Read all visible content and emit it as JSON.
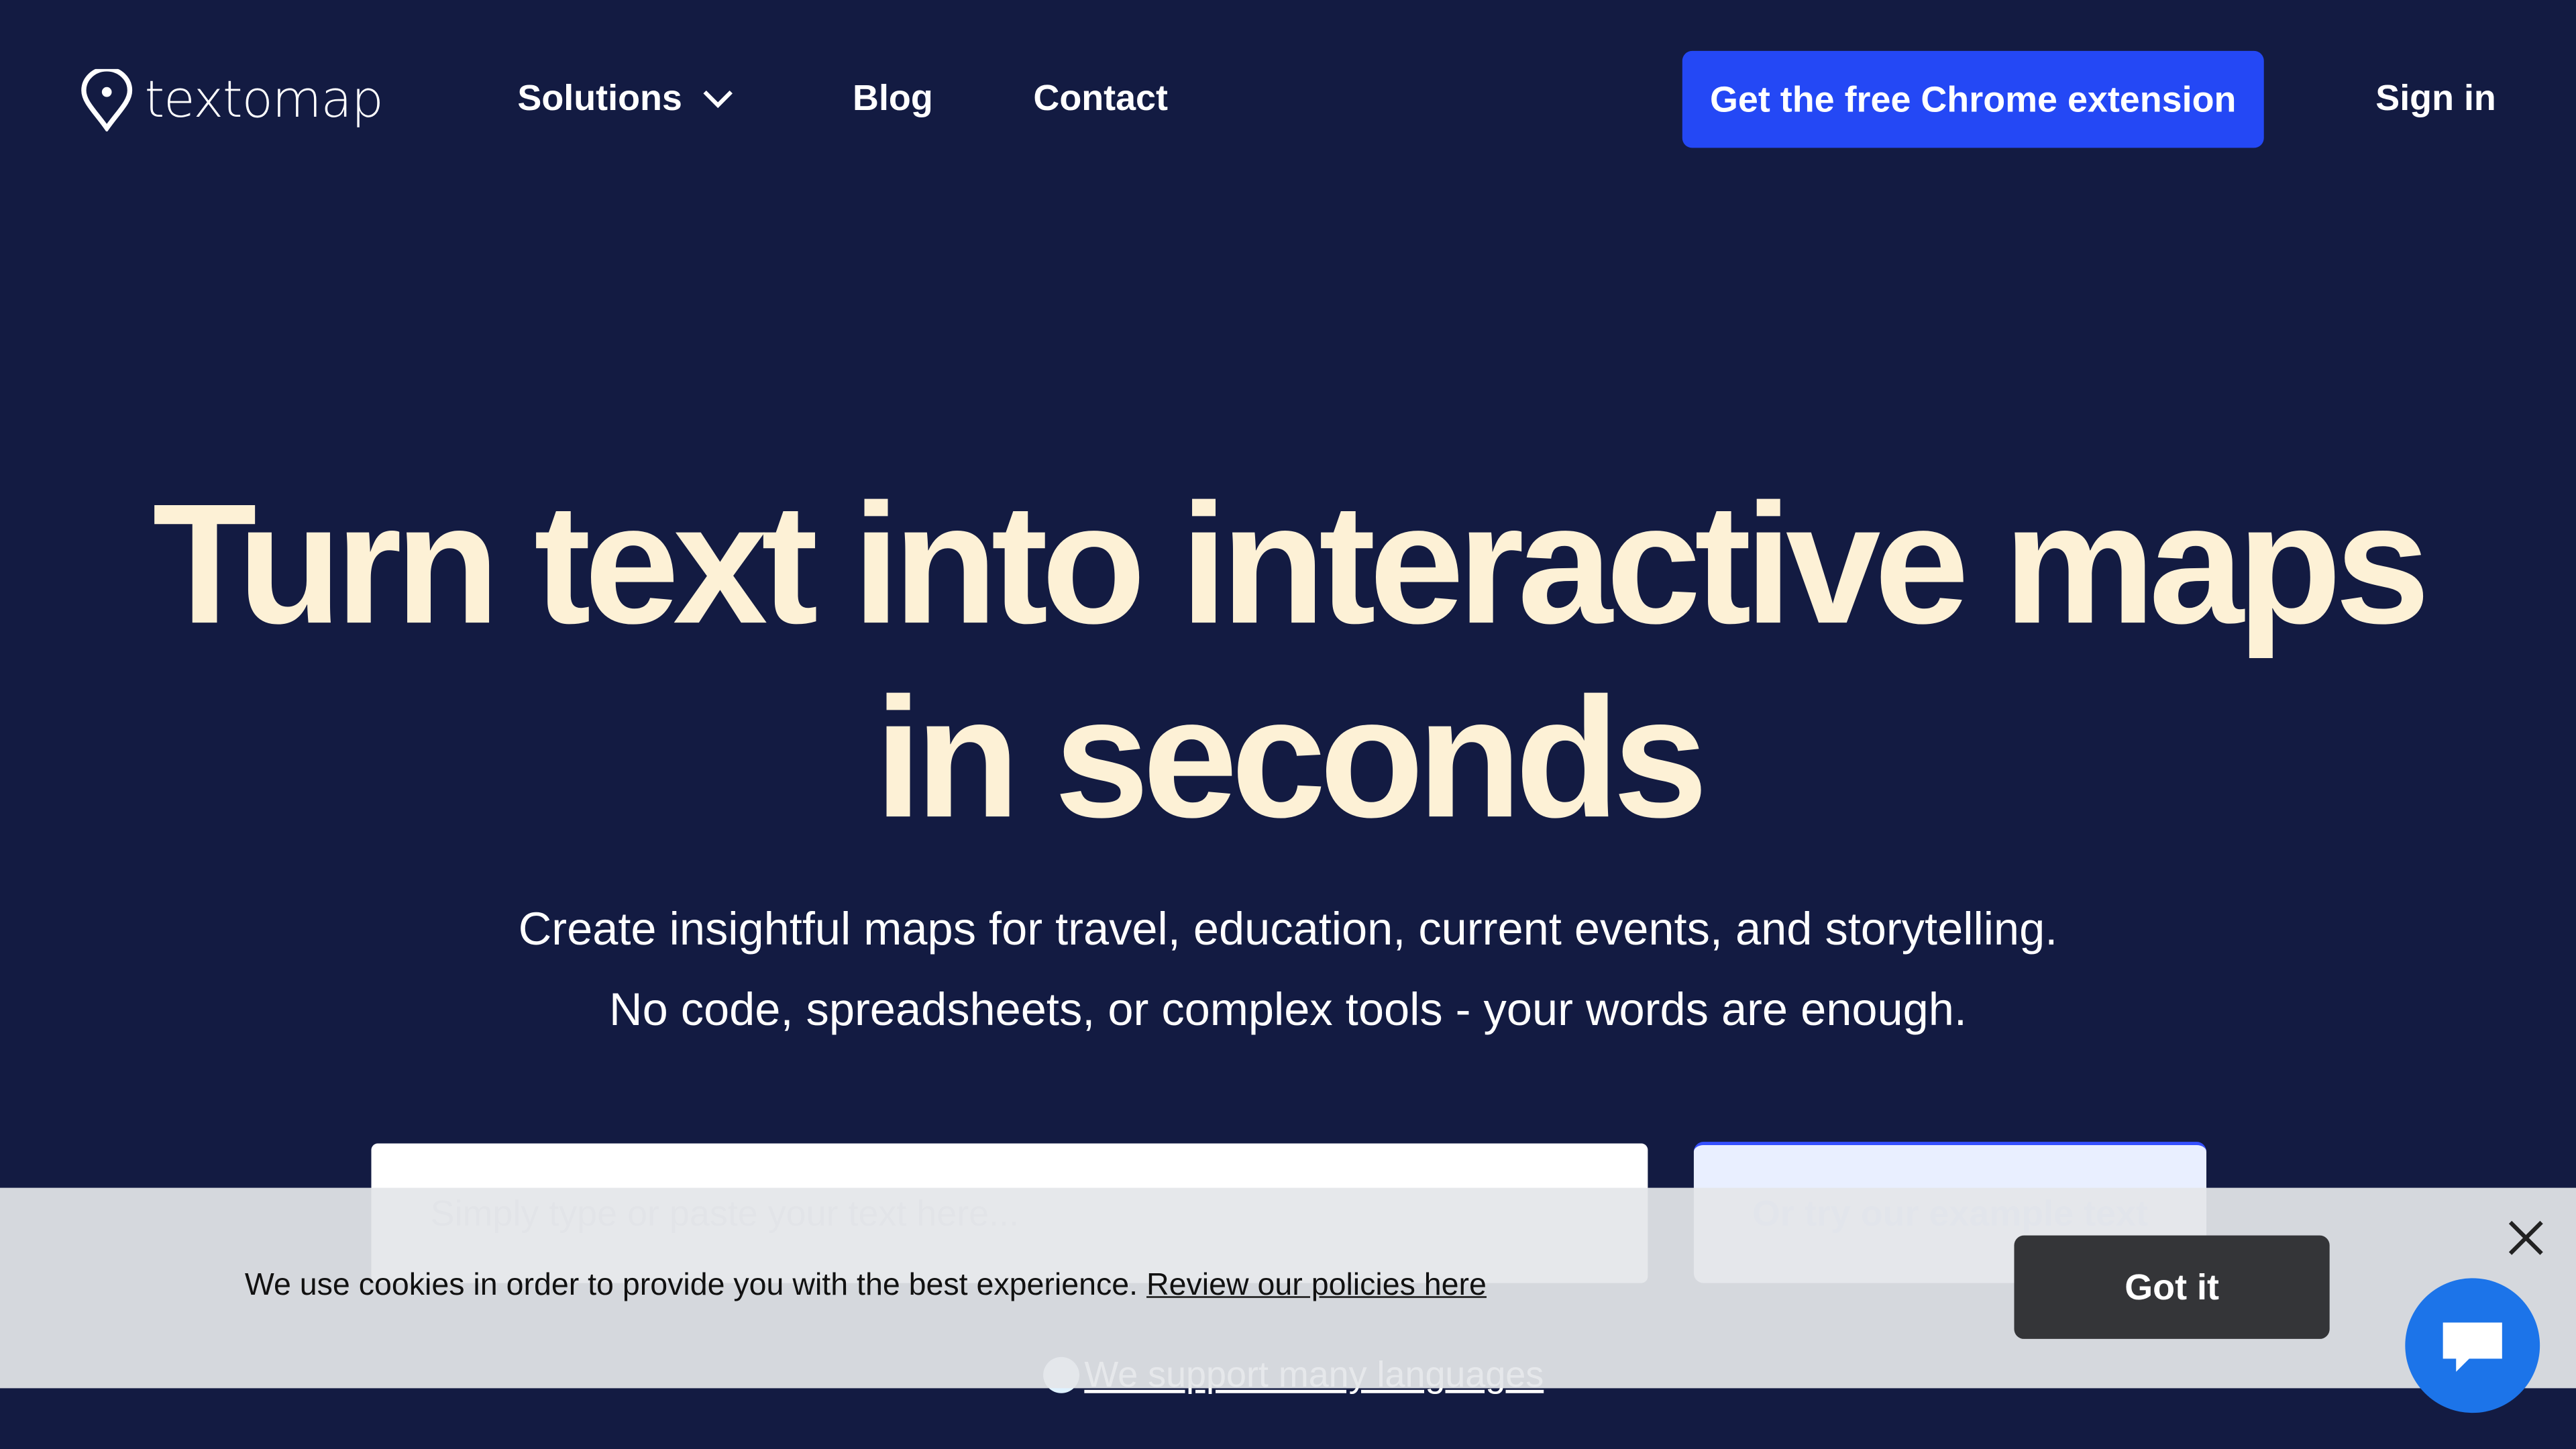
{
  "header": {
    "logo_text": "textomap",
    "nav": [
      {
        "label": "Solutions",
        "has_dropdown": true
      },
      {
        "label": "Blog"
      },
      {
        "label": "Contact"
      }
    ],
    "cta_label": "Get the free Chrome extension",
    "signin_label": "Sign in"
  },
  "hero": {
    "headline_line1": "Turn text into interactive maps",
    "headline_line2": "in seconds",
    "subtitle_line1": "Create insightful maps for travel, education, current events, and storytelling.",
    "subtitle_line2": "No code, spreadsheets, or complex tools - your words are enough.",
    "input_placeholder": "Simply type or paste your text here...",
    "example_button": "Or try our example text",
    "languages_link": "We support many languages"
  },
  "cookie_banner": {
    "text": "We use cookies in order to provide you with the best experience.",
    "link": "Review our policies here",
    "accept_label": "Got it"
  },
  "colors": {
    "background": "#131b42",
    "headline": "#fdf1d6",
    "accent": "#2448f5",
    "chat": "#1c74e9"
  }
}
